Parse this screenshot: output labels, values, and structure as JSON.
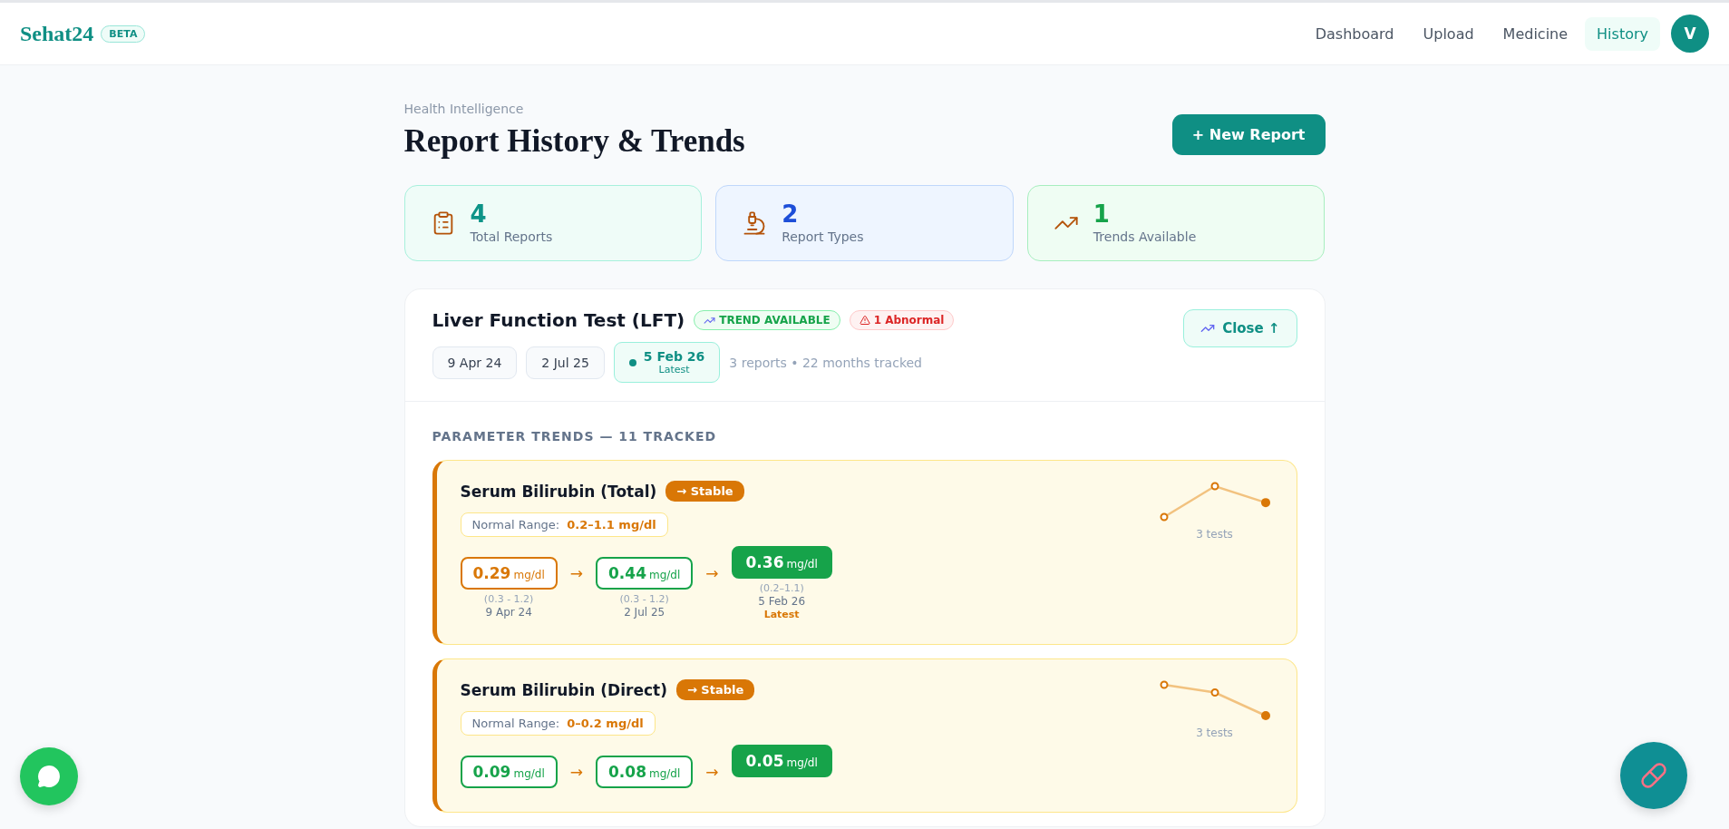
{
  "brand": {
    "name": "Sehat24",
    "badge": "BETA"
  },
  "nav": [
    {
      "label": "Dashboard",
      "selected": false
    },
    {
      "label": "Upload",
      "selected": false
    },
    {
      "label": "Medicine",
      "selected": false
    },
    {
      "label": "History",
      "selected": true
    }
  ],
  "avatar": {
    "initial": "V"
  },
  "page": {
    "eyebrow": "Health Intelligence",
    "title": "Report History & Trends",
    "new_report_button": "+ New Report"
  },
  "stats": [
    {
      "kind": "reports",
      "value": "4",
      "label": "Total Reports",
      "color": "#0d9488"
    },
    {
      "kind": "types",
      "value": "2",
      "label": "Report Types",
      "color": "#1d4ed8"
    },
    {
      "kind": "trends",
      "value": "1",
      "label": "Trends Available",
      "color": "#16a34a"
    }
  ],
  "report": {
    "title": "Liver Function Test (LFT)",
    "trend_badge": "TREND AVAILABLE",
    "abnormal_badge": "1 Abnormal",
    "close_button": "Close ↑",
    "dates": [
      {
        "label": "9 Apr 24",
        "selected": false
      },
      {
        "label": "2 Jul 25",
        "selected": false
      },
      {
        "label": "5 Feb 26",
        "sub": "Latest",
        "selected": true
      }
    ],
    "summary": "3 reports • 22 months tracked",
    "section_title": "PARAMETER TRENDS — 11 TRACKED",
    "parameters": [
      {
        "name": "Serum Bilirubin (Total)",
        "trend": "→ Stable",
        "range_label": "Normal Range:",
        "range": "0.2–1.1 mg/dl",
        "tests": "3 tests",
        "arrow": "→",
        "readings": [
          {
            "value": "0.29",
            "unit": "mg/dl",
            "abnormal": true,
            "latest": false,
            "range": "(0.3 - 1.2)",
            "date": "9 Apr 24"
          },
          {
            "value": "0.44",
            "unit": "mg/dl",
            "abnormal": false,
            "latest": false,
            "range": "(0.3 - 1.2)",
            "date": "2 Jul 25"
          },
          {
            "value": "0.36",
            "unit": "mg/dl",
            "abnormal": false,
            "latest": true,
            "range": "(0.2–1.1)",
            "date": "5 Feb 26",
            "latest_label": "Latest"
          }
        ]
      },
      {
        "name": "Serum Bilirubin (Direct)",
        "trend": "→ Stable",
        "range_label": "Normal Range:",
        "range": "0–0.2 mg/dl",
        "tests": "3 tests",
        "arrow": "→",
        "readings": [
          {
            "value": "0.09",
            "unit": "mg/dl",
            "abnormal": false,
            "latest": false
          },
          {
            "value": "0.08",
            "unit": "mg/dl",
            "abnormal": false,
            "latest": false
          },
          {
            "value": "0.05",
            "unit": "mg/dl",
            "abnormal": false,
            "latest": true
          }
        ]
      }
    ]
  }
}
